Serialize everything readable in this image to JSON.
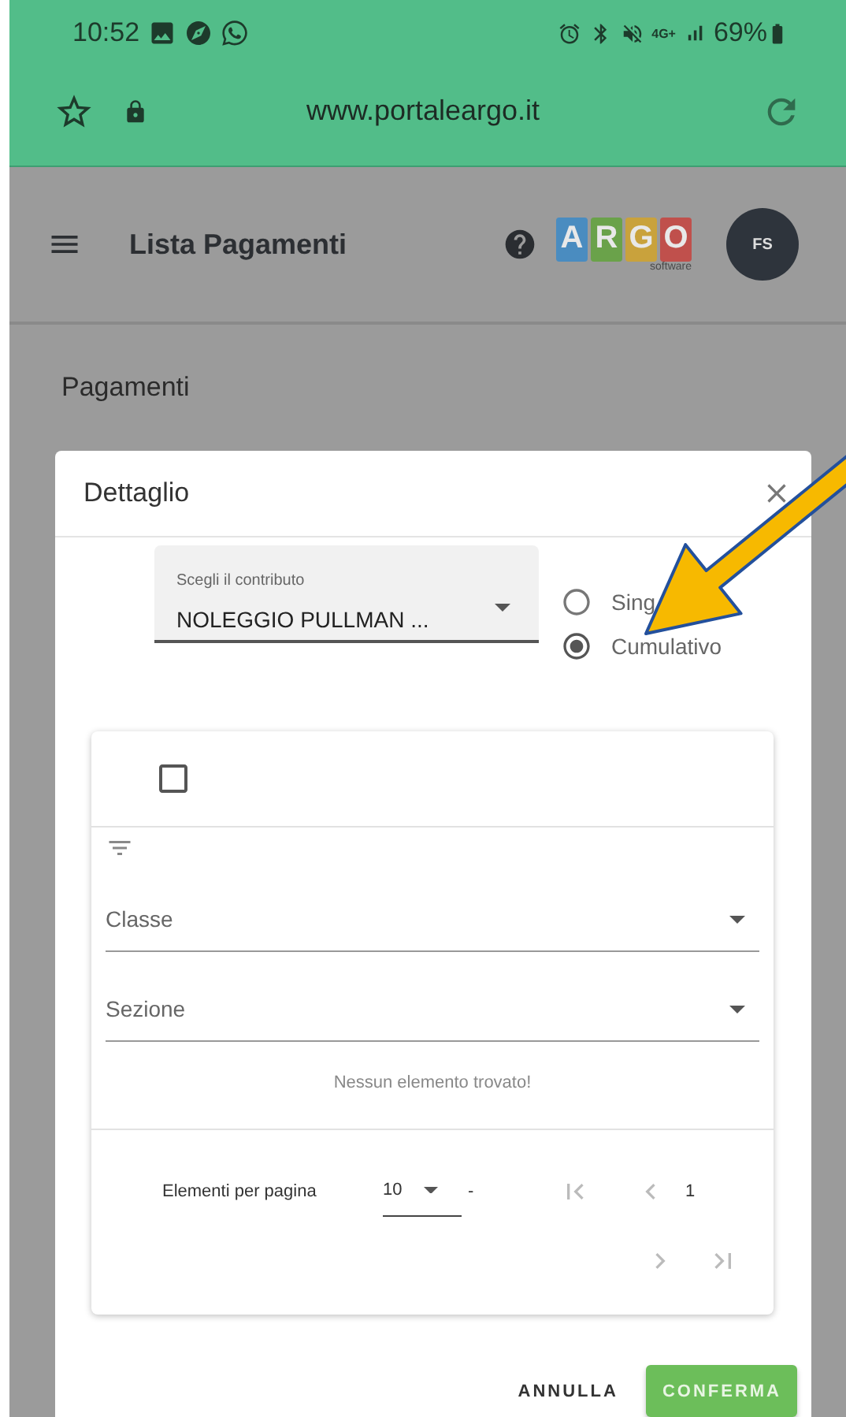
{
  "status_bar": {
    "time": "10:52",
    "network": "4G+",
    "battery": "69%"
  },
  "browser": {
    "url": "www.portaleargo.it"
  },
  "app_bar": {
    "title": "Lista Pagamenti",
    "logo_letters": [
      {
        "letter": "A",
        "color": "#4a8cc0"
      },
      {
        "letter": "R",
        "color": "#6aa24a"
      },
      {
        "letter": "G",
        "color": "#c9a23c"
      },
      {
        "letter": "O",
        "color": "#c0504c"
      }
    ],
    "logo_caption": "software",
    "avatar": "FS"
  },
  "page": {
    "heading": "Pagamenti"
  },
  "dialog": {
    "title": "Dettaglio",
    "contribution_select": {
      "label": "Scegli il contributo",
      "value": "NOLEGGIO PULLMAN ..."
    },
    "modes": [
      {
        "label": "Sing",
        "selected": false
      },
      {
        "label": "Cumulativo",
        "selected": true
      }
    ],
    "table": {
      "select_all_checked": false,
      "filters": [
        {
          "label": "Classe"
        },
        {
          "label": "Sezione"
        }
      ],
      "empty_message": "Nessun elemento trovato!",
      "pagination": {
        "rows_label": "Elementi per pagina",
        "rows_value": "10",
        "range": "-",
        "page": "1"
      }
    },
    "buttons": [
      {
        "label": "ANNULLA",
        "kind": "text"
      },
      {
        "label": "CONFERMA",
        "kind": "primary"
      }
    ]
  }
}
